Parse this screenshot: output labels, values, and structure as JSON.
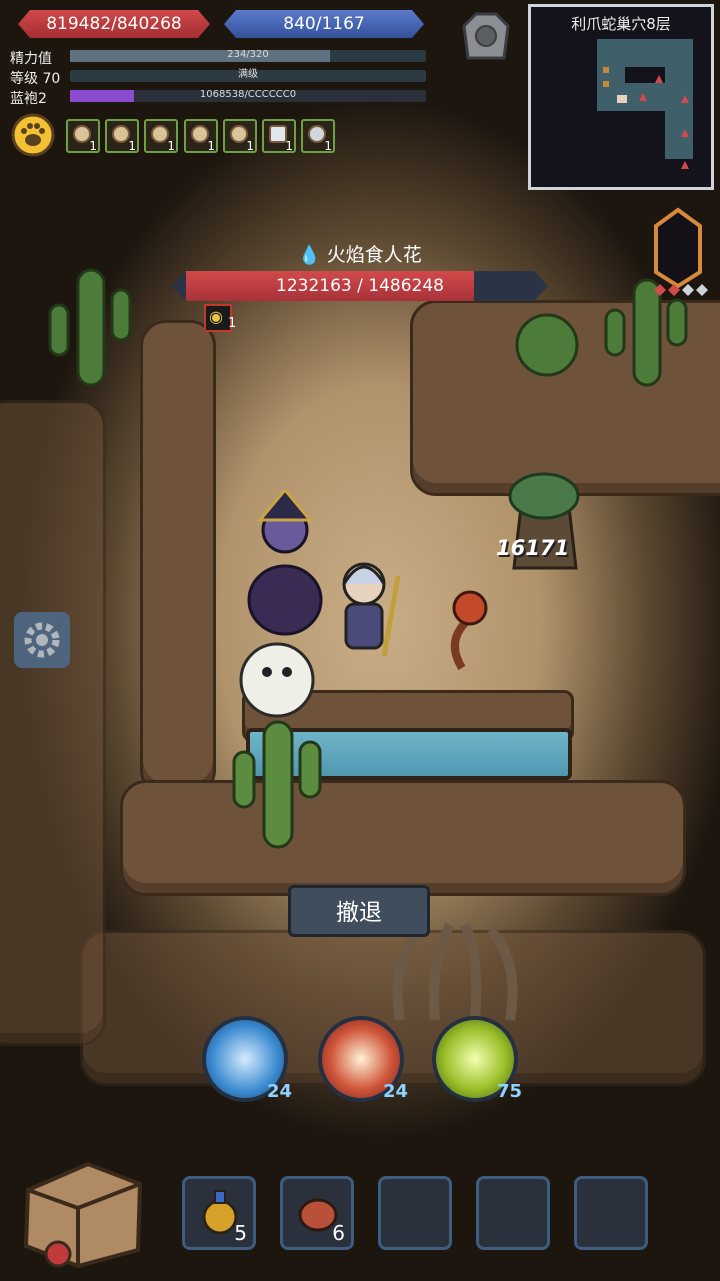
{
  "player": {
    "hp": "819482/840268",
    "mp": "840/1167"
  },
  "stats": [
    {
      "label": "精力值",
      "value": "234/320",
      "fill": 0.73
    },
    {
      "label": "等级 70",
      "value": "满级",
      "fill": 1.0
    },
    {
      "label": "蓝袍2",
      "value": "1068538/CCCCCC0",
      "fill": 0.18
    }
  ],
  "colors": {
    "hp": "#c33a3f",
    "mp": "#4263b1",
    "accent_purple": "#8a4bd0",
    "buff_border": "#6ea045",
    "cd_text": "#8fd2ff"
  },
  "buffs": [
    "1",
    "1",
    "1",
    "1",
    "1",
    "1",
    "1"
  ],
  "minimap": {
    "title": "利爪蛇巢穴8层"
  },
  "boss": {
    "element_icon": "water-drop-icon",
    "name": "火焰食人花",
    "hp_text": "1232163 / 1486248",
    "hp_fraction": 0.829,
    "debuff_count": "1"
  },
  "damage_number": "16171",
  "retreat_label": "撤退",
  "skills": [
    {
      "icon": "ice-burst-icon",
      "cd": "24"
    },
    {
      "icon": "fire-pillar-icon",
      "cd": "24"
    },
    {
      "icon": "poison-bubbles-icon",
      "cd": "75"
    }
  ],
  "items": [
    {
      "icon": "potion-bottle-icon",
      "count": "5"
    },
    {
      "icon": "meat-icon",
      "count": "6"
    },
    {
      "icon": "empty-slot",
      "count": ""
    },
    {
      "icon": "empty-slot",
      "count": ""
    },
    {
      "icon": "empty-slot",
      "count": ""
    }
  ]
}
